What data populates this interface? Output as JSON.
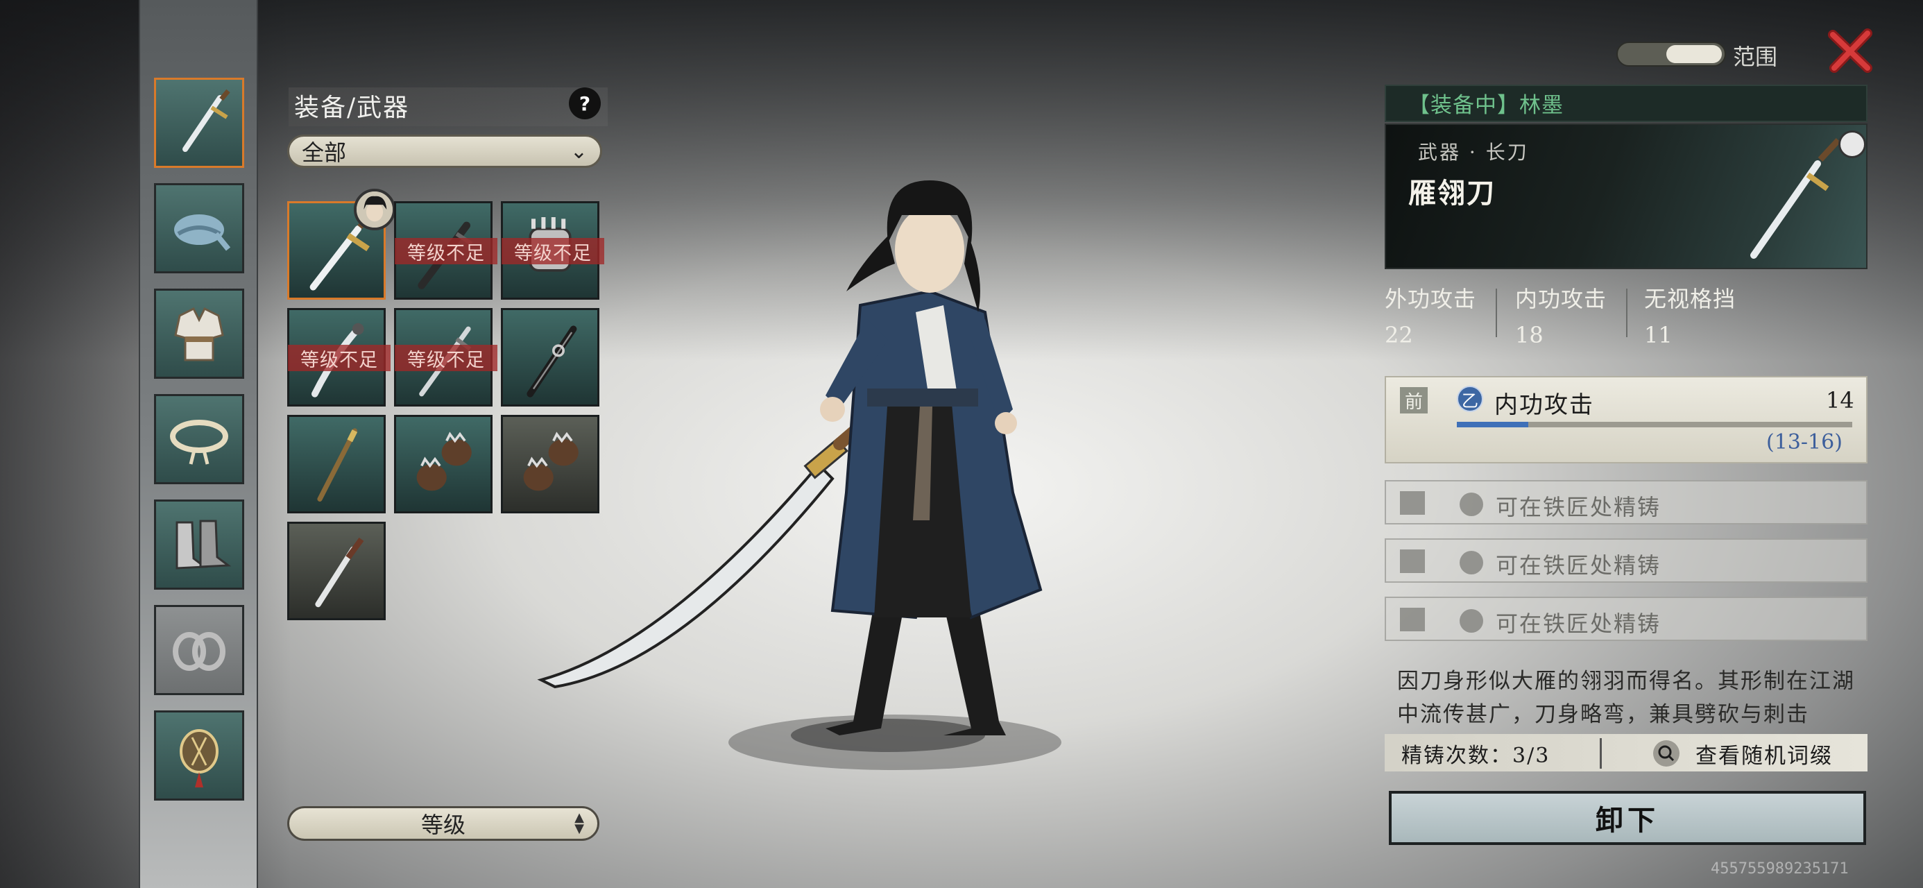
{
  "inventory": {
    "title": "装备/武器",
    "help": "?",
    "filter": "全部",
    "sort": "等级",
    "items": [
      {
        "icon": "sword-icon",
        "selected": true,
        "equipped": true,
        "locked": ""
      },
      {
        "icon": "dark-sword-icon",
        "locked": "等级不足"
      },
      {
        "icon": "gauntlet-icon",
        "locked": "等级不足"
      },
      {
        "icon": "saber-icon",
        "locked": "等级不足"
      },
      {
        "icon": "thin-sword-icon",
        "locked": "等级不足"
      },
      {
        "icon": "black-sword-icon",
        "locked": ""
      },
      {
        "icon": "staff-icon",
        "locked": ""
      },
      {
        "icon": "spiked-fists-icon",
        "locked": ""
      },
      {
        "icon": "spiked-fists-icon",
        "locked": ""
      },
      {
        "icon": "dagger-icon",
        "locked": ""
      }
    ]
  },
  "slots": [
    {
      "icon": "weapon-slot-icon",
      "active": true
    },
    {
      "icon": "headband-icon"
    },
    {
      "icon": "armor-icon"
    },
    {
      "icon": "belt-icon"
    },
    {
      "icon": "boots-icon"
    },
    {
      "icon": "bracer-icon",
      "disabled": true
    },
    {
      "icon": "accessory-icon"
    }
  ],
  "top_right": {
    "range_label": "范围"
  },
  "detail": {
    "equip_label": "【装备中】林墨",
    "weapon_type": "武器 · 长刀",
    "weapon_name": "雁翎刀",
    "stats": [
      {
        "label": "外功攻击",
        "value": "22"
      },
      {
        "label": "内功攻击",
        "value": "18"
      },
      {
        "label": "无视格挡",
        "value": "11"
      }
    ],
    "attribute": {
      "tag": "前",
      "grade": "乙",
      "name": "内功攻击",
      "value": "14",
      "range": "(13-16)",
      "progress": 0.18
    },
    "refine_slots": [
      "可在铁匠处精铸",
      "可在铁匠处精铸",
      "可在铁匠处精铸"
    ],
    "description": "因刀身形似大雁的翎羽而得名。其形制在江湖中流传甚广，刀身略弯，兼具劈砍与刺击",
    "refine_count": "精铸次数：3/3",
    "view_affix": "查看随机词缀",
    "unequip": "卸下"
  },
  "watermark": "455755989235171",
  "colors": {
    "equipped_green": "#6fc18c",
    "select_border": "#d97a2a",
    "locked_red": "#a02828",
    "attr_blue": "#3f70b8"
  }
}
